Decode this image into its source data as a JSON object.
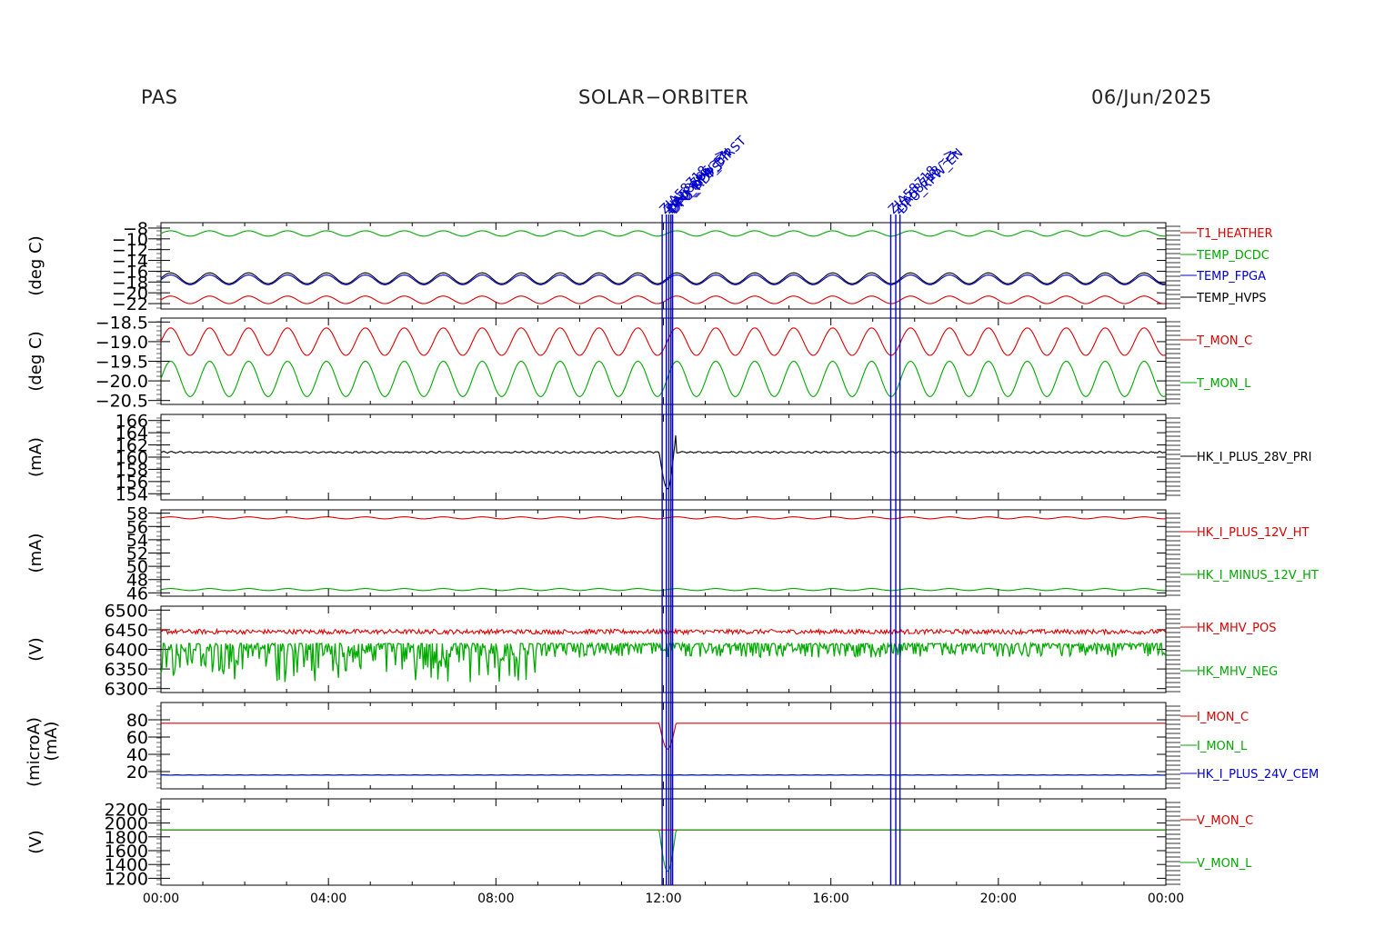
{
  "header": {
    "instrument": "PAS",
    "mission": "SOLAR−ORBITER",
    "date": "06/Jun/2025"
  },
  "chart_data": {
    "type": "line",
    "x_ticks": [
      "00:00",
      "04:00",
      "08:00",
      "12:00",
      "16:00",
      "20:00",
      "00:00"
    ],
    "xlim_hours": [
      0,
      24
    ],
    "events": [
      {
        "t": 11.97,
        "label": "ZIA58718 ~>"
      },
      {
        "t": 12.07,
        "label": "ZIA58706 ~>"
      },
      {
        "t": 12.13,
        "label": "DPU_RPW_EN"
      },
      {
        "t": 12.18,
        "label": "DPU_DPS_DIRST"
      },
      {
        "t": 12.22,
        "label": "DPU_RDPS"
      },
      {
        "t": 17.43,
        "label": "ZIA58718 ~>"
      },
      {
        "t": 17.55,
        "label": "ZIA58718 ~>"
      },
      {
        "t": 17.65,
        "label": "DPU_RPW_EN"
      }
    ],
    "panels": [
      {
        "ylabel": "(deg C)",
        "ylim": [
          -23,
          -7
        ],
        "tick_labels": [
          "−8",
          "−10",
          "−12",
          "−14",
          "−16",
          "−18",
          "−20",
          "−22"
        ],
        "tick_values": [
          -8,
          -10,
          -12,
          -14,
          -16,
          -18,
          -20,
          -22
        ],
        "series": [
          {
            "name": "T1_HEATHER",
            "color": "#dd0000",
            "mean": -21.3,
            "amp": 0.7,
            "period_h": 0.93
          },
          {
            "name": "TEMP_DCDC",
            "color": "#00aa00",
            "mean": -9.0,
            "amp": 0.5,
            "period_h": 0.93
          },
          {
            "name": "TEMP_FPGA",
            "color": "#0000cc",
            "mean": -17.6,
            "amp": 0.9,
            "period_h": 0.93
          },
          {
            "name": "TEMP_HVPS",
            "color": "#000000",
            "mean": -17.3,
            "amp": 1.0,
            "period_h": 0.93
          }
        ]
      },
      {
        "ylabel": "(deg C)",
        "ylim": [
          -20.6,
          -18.4
        ],
        "tick_labels": [
          "−18.5",
          "−19.0",
          "−19.5",
          "−20.0",
          "−20.5"
        ],
        "tick_values": [
          -18.5,
          -19.0,
          -19.5,
          -20.0,
          -20.5
        ],
        "series": [
          {
            "name": "T_MON_C",
            "color": "#dd0000",
            "mean": -19.0,
            "amp": 0.35,
            "period_h": 0.93
          },
          {
            "name": "T_MON_L",
            "color": "#00aa00",
            "mean": -19.95,
            "amp": 0.45,
            "period_h": 0.93
          }
        ]
      },
      {
        "ylabel": "(mA)",
        "ylim": [
          153,
          167
        ],
        "tick_labels": [
          "166",
          "164",
          "162",
          "160",
          "158",
          "156",
          "154"
        ],
        "tick_values": [
          166,
          164,
          162,
          160,
          158,
          156,
          154
        ],
        "series": [
          {
            "name": "HK_I_PLUS_28V_PRI",
            "color": "#000000",
            "mean": 160.8,
            "amp": 0.1,
            "period_h": 0.2,
            "noise": 0.15
          }
        ]
      },
      {
        "ylabel": "(mA)",
        "ylim": [
          45.5,
          58.5
        ],
        "tick_labels": [
          "58",
          "56",
          "54",
          "52",
          "50",
          "48",
          "46"
        ],
        "tick_values": [
          58,
          56,
          54,
          52,
          50,
          48,
          46
        ],
        "series": [
          {
            "name": "HK_I_PLUS_12V_HT",
            "color": "#dd0000",
            "mean": 57.3,
            "amp": 0.15,
            "period_h": 0.93
          },
          {
            "name": "HK_I_MINUS_12V_HT",
            "color": "#00aa00",
            "mean": 46.5,
            "amp": 0.15,
            "period_h": 0.93
          }
        ]
      },
      {
        "ylabel": "(V)",
        "ylim": [
          6290,
          6510
        ],
        "tick_labels": [
          "6500",
          "6450",
          "6400",
          "6350",
          "6300"
        ],
        "tick_values": [
          6500,
          6450,
          6400,
          6350,
          6300
        ],
        "series": [
          {
            "name": "HK_MHV_POS",
            "color": "#dd0000",
            "mean": 6445,
            "amp": 10,
            "period_h": 0.3,
            "noise": 12
          },
          {
            "name": "HK_MHV_NEG",
            "color": "#00aa00",
            "mean": 6415,
            "amp": 10,
            "period_h": 0.3,
            "noise": 45
          }
        ]
      },
      {
        "ylabel": "(microA)",
        "ylabel2": "(mA)",
        "ylim": [
          0,
          100
        ],
        "tick_labels": [
          "80",
          "60",
          "40",
          "20"
        ],
        "tick_values": [
          80,
          60,
          40,
          20
        ],
        "series": [
          {
            "name": "I_MON_C",
            "color": "#dd0000",
            "mean": 76,
            "amp": 0,
            "period_h": 1
          },
          {
            "name": "I_MON_L",
            "color": "#00aa00",
            "mean": 16,
            "amp": 0,
            "period_h": 1
          },
          {
            "name": "HK_I_PLUS_24V_CEM",
            "color": "#0000cc",
            "mean": 16,
            "amp": 0.2,
            "period_h": 0.3
          }
        ]
      },
      {
        "ylabel": "(V)",
        "ylim": [
          1100,
          2350
        ],
        "tick_labels": [
          "2200",
          "2000",
          "1800",
          "1600",
          "1400",
          "1200"
        ],
        "tick_values": [
          2200,
          2000,
          1800,
          1600,
          1400,
          1200
        ],
        "series": [
          {
            "name": "V_MON_C",
            "color": "#dd0000",
            "mean": 1900,
            "amp": 0,
            "period_h": 1
          },
          {
            "name": "V_MON_L",
            "color": "#00aa00",
            "mean": 1900,
            "amp": 0,
            "period_h": 1
          }
        ]
      }
    ]
  }
}
